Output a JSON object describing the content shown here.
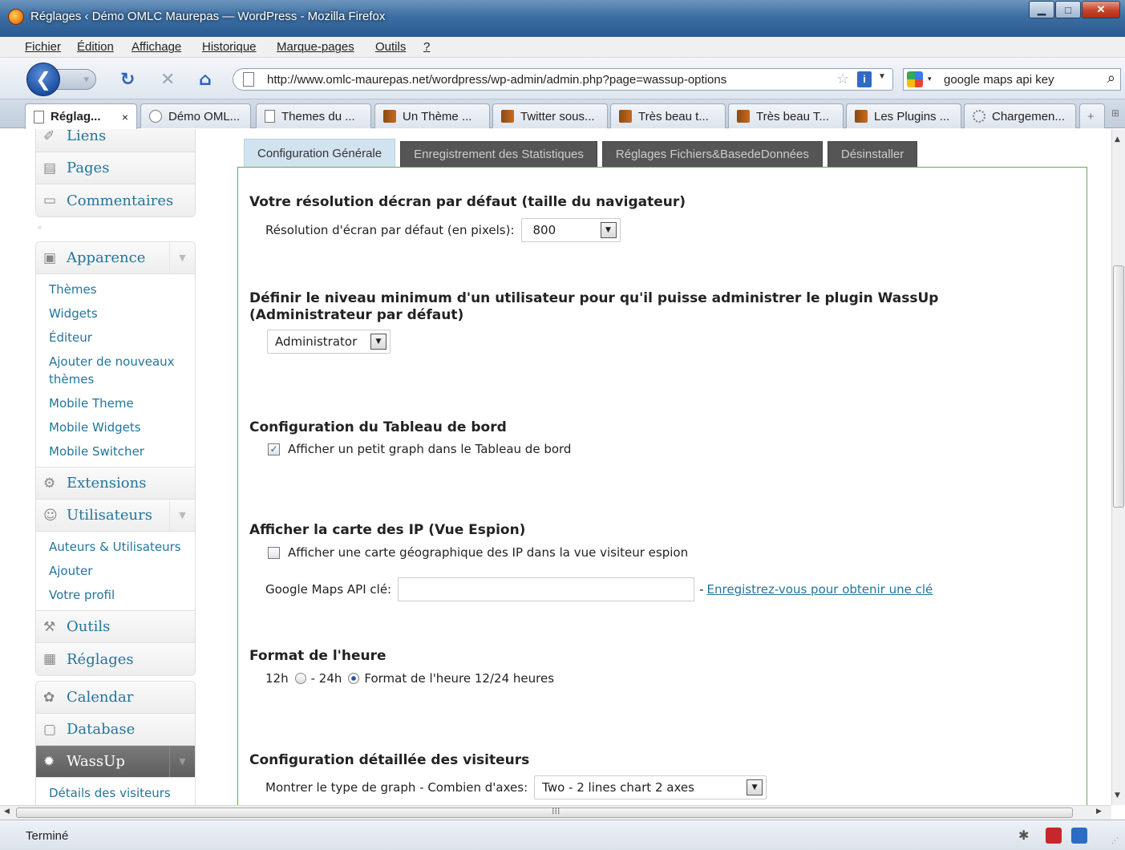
{
  "window": {
    "title": "Réglages ‹ Démo OMLC Maurepas — WordPress - Mozilla Firefox"
  },
  "menubar": [
    "Fichier",
    "Édition",
    "Affichage",
    "Historique",
    "Marque-pages",
    "Outils",
    "?"
  ],
  "navbar": {
    "url": "http://www.omlc-maurepas.net/wordpress/wp-admin/admin.php?page=wassup-options",
    "search_value": "google maps api key"
  },
  "tabs": [
    {
      "label": "Réglag...",
      "icon": "doc"
    },
    {
      "label": "Démo OML...",
      "icon": "wp"
    },
    {
      "label": "Themes du ...",
      "icon": "doc"
    },
    {
      "label": "Un Thème ...",
      "icon": "brown"
    },
    {
      "label": "Twitter sous...",
      "icon": "brown"
    },
    {
      "label": "Très beau t...",
      "icon": "brown"
    },
    {
      "label": "Très beau T...",
      "icon": "brown"
    },
    {
      "label": "Les Plugins ...",
      "icon": "brown"
    },
    {
      "label": "Chargemen...",
      "icon": "loading"
    }
  ],
  "sidebar": {
    "group1": [
      {
        "label": "Liens",
        "icon": "link-icon"
      },
      {
        "label": "Pages",
        "icon": "pages-icon"
      },
      {
        "label": "Commentaires",
        "icon": "comments-icon"
      }
    ],
    "apparence": {
      "label": "Apparence",
      "items": [
        "Thèmes",
        "Widgets",
        "Éditeur",
        "Ajouter de nouveaux thèmes",
        "Mobile Theme",
        "Mobile Widgets",
        "Mobile Switcher"
      ]
    },
    "extensions": "Extensions",
    "utilisateurs": {
      "label": "Utilisateurs",
      "items": [
        "Auteurs & Utilisateurs",
        "Ajouter",
        "Votre profil"
      ]
    },
    "outils": "Outils",
    "reglages": "Réglages",
    "group3": {
      "calendar": "Calendar",
      "database": "Database",
      "wassup": "WassUp",
      "items": [
        "Détails des visiteurs"
      ]
    }
  },
  "content_tabs": [
    "Configuration Générale",
    "Enregistrement des Statistiques",
    "Réglages Fichiers&BasedeDonnées",
    "Désinstaller"
  ],
  "sections": {
    "resolution": {
      "title": "Votre résolution décran par défaut (taille du navigateur)",
      "label": "Résolution d'écran par défaut (en pixels):",
      "value": "800"
    },
    "userlevel": {
      "title": "Définir le niveau minimum d'un utilisateur pour qu'il puisse administrer le plugin WassUp (Administrateur par défaut)",
      "value": "Administrator"
    },
    "dashboard": {
      "title": "Configuration du Tableau de bord",
      "checkbox_label": "Afficher un petit graph dans le Tableau de bord",
      "checked": true
    },
    "ipmap": {
      "title": "Afficher la carte des IP (Vue Espion)",
      "checkbox_label": "Afficher une carte géographique des IP dans la vue visiteur espion",
      "checked": false,
      "api_label": "Google Maps API clé:",
      "api_value": "",
      "link_prefix": "-",
      "link_text": "Enregistrez-vous pour obtenir une clé"
    },
    "timeformat": {
      "title": "Format de l'heure",
      "opt12": "12h",
      "opt24": "- 24h",
      "description": "Format de l'heure 12/24 heures",
      "selected": "24h"
    },
    "visitors": {
      "title": "Configuration détaillée des visiteurs",
      "label": "Montrer le type de graph - Combien d'axes:",
      "value": "Two - 2 lines chart 2 axes"
    }
  },
  "statusbar": {
    "text": "Terminé"
  }
}
